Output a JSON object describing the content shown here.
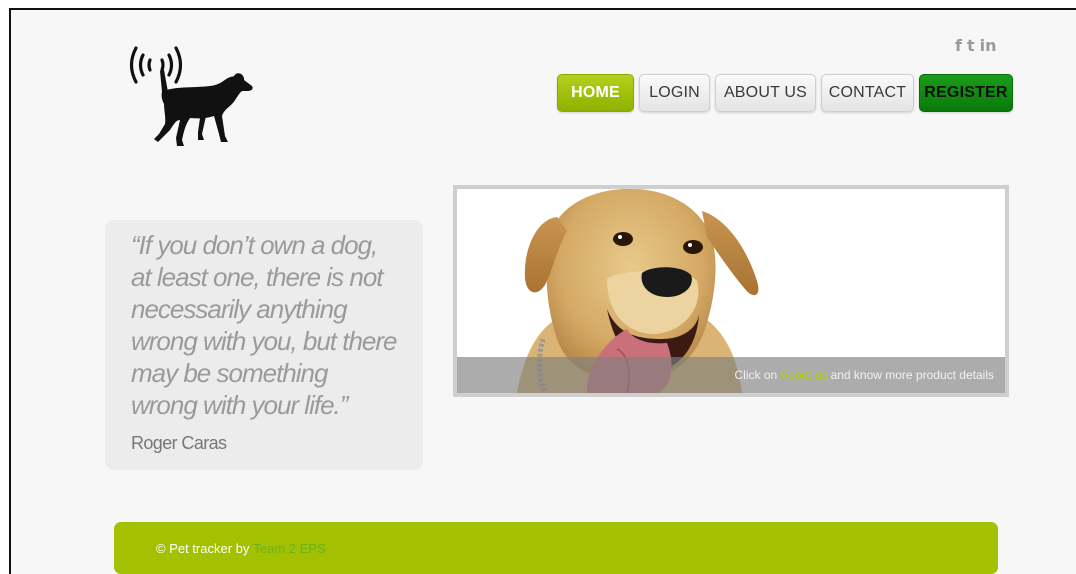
{
  "social": {
    "facebook": "f",
    "twitter": "t",
    "linkedin": "in"
  },
  "nav": {
    "home": "HOME",
    "login": "LOGIN",
    "about": "ABOUT US",
    "contact": "CONTACT",
    "register": "REGISTER"
  },
  "quote": {
    "text": "“If you don’t own a dog, at least one, there is not necessarily anything wrong with you, but there may be something wrong with your life.”",
    "author": "Roger Caras"
  },
  "banner": {
    "caption_prefix": "Click on",
    "caption_link": "About us",
    "caption_suffix": "and know more product details"
  },
  "footer": {
    "prefix": "© Pet tracker by",
    "team": "Team 2 EPS"
  },
  "colors": {
    "accent_green": "#a3c100",
    "register_green": "#0a7a0a",
    "link_green": "#a8d400"
  }
}
